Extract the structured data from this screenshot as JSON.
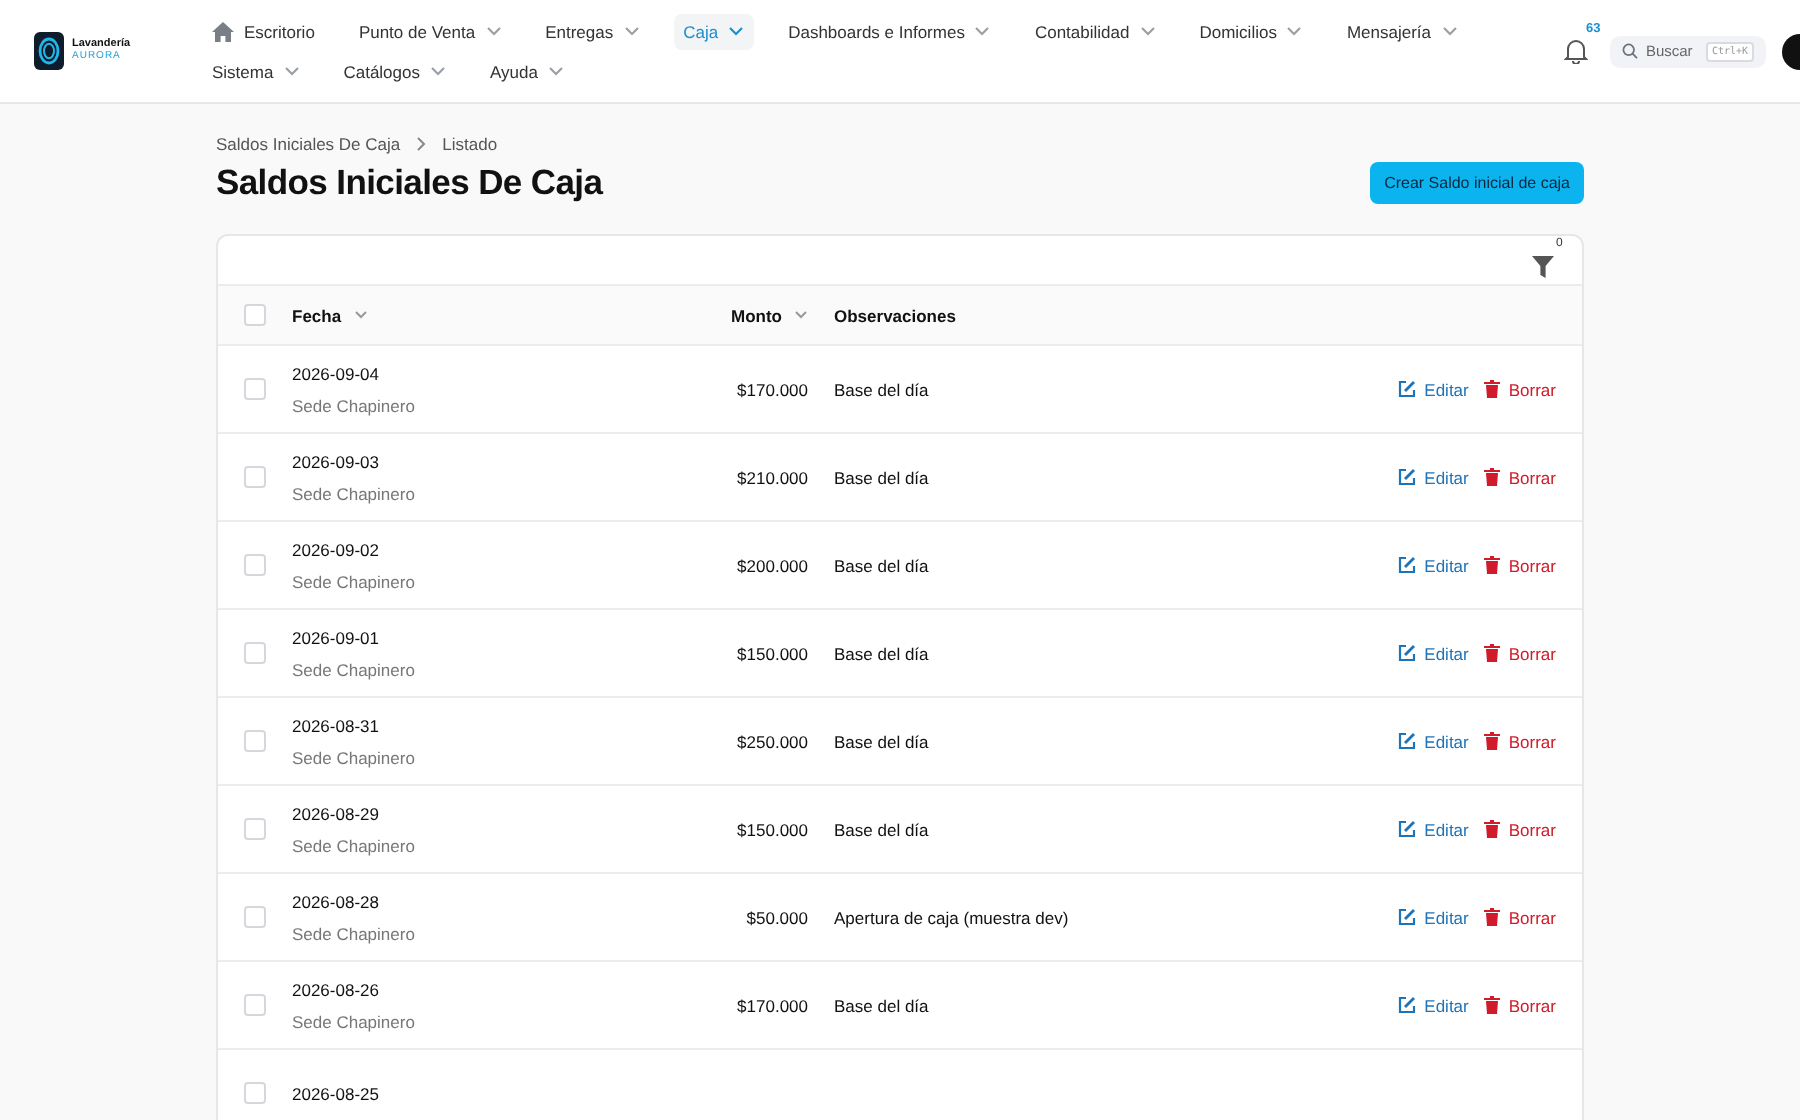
{
  "brand": {
    "name": "Lavandería",
    "tagline": "AURORA"
  },
  "nav": [
    {
      "label": "Escritorio",
      "kind": "home",
      "selected": false
    },
    {
      "label": "Punto de Venta",
      "kind": "menu",
      "selected": false
    },
    {
      "label": "Entregas",
      "kind": "menu",
      "selected": false
    },
    {
      "label": "Caja",
      "kind": "menu",
      "selected": true
    },
    {
      "label": "Dashboards e Informes",
      "kind": "menu",
      "selected": false
    },
    {
      "label": "Contabilidad",
      "kind": "menu",
      "selected": false
    },
    {
      "label": "Domicilios",
      "kind": "menu",
      "selected": false
    },
    {
      "label": "Mensajería",
      "kind": "menu",
      "selected": false
    },
    {
      "label": "Sistema",
      "kind": "menu",
      "selected": false
    },
    {
      "label": "Catálogos",
      "kind": "menu",
      "selected": false
    },
    {
      "label": "Ayuda",
      "kind": "menu",
      "selected": false
    }
  ],
  "notifications": {
    "count": "63"
  },
  "search": {
    "placeholder": "Buscar",
    "shortcut": "Ctrl+K"
  },
  "breadcrumbs": [
    "Saldos Iniciales De Caja",
    "Listado"
  ],
  "title": "Saldos Iniciales De Caja",
  "create_button": "Crear Saldo inicial de caja",
  "filter": {
    "count": "0"
  },
  "table": {
    "select_all": {
      "checked": false
    },
    "columns": [
      {
        "label": "Fecha",
        "sortable": true
      },
      {
        "label": "Monto",
        "sortable": true
      },
      {
        "label": "Observaciones",
        "sortable": false
      }
    ],
    "rows": [
      {
        "fecha": "2026-09-04",
        "sede": "Sede Chapinero",
        "monto": "$170.000",
        "observaciones": "Base del día",
        "edit": "Editar",
        "delete": "Borrar",
        "selected": false
      },
      {
        "fecha": "2026-09-03",
        "sede": "Sede Chapinero",
        "monto": "$210.000",
        "observaciones": "Base del día",
        "edit": "Editar",
        "delete": "Borrar",
        "selected": false
      },
      {
        "fecha": "2026-09-02",
        "sede": "Sede Chapinero",
        "monto": "$200.000",
        "observaciones": "Base del día",
        "edit": "Editar",
        "delete": "Borrar",
        "selected": false
      },
      {
        "fecha": "2026-09-01",
        "sede": "Sede Chapinero",
        "monto": "$150.000",
        "observaciones": "Base del día",
        "edit": "Editar",
        "delete": "Borrar",
        "selected": false
      },
      {
        "fecha": "2026-08-31",
        "sede": "Sede Chapinero",
        "monto": "$250.000",
        "observaciones": "Base del día",
        "edit": "Editar",
        "delete": "Borrar",
        "selected": false
      },
      {
        "fecha": "2026-08-29",
        "sede": "Sede Chapinero",
        "monto": "$150.000",
        "observaciones": "Base del día",
        "edit": "Editar",
        "delete": "Borrar",
        "selected": false
      },
      {
        "fecha": "2026-08-28",
        "sede": "Sede Chapinero",
        "monto": "$50.000",
        "observaciones": "Apertura de caja (muestra dev)",
        "edit": "Editar",
        "delete": "Borrar",
        "selected": false
      },
      {
        "fecha": "2026-08-26",
        "sede": "Sede Chapinero",
        "monto": "$170.000",
        "observaciones": "Base del día",
        "edit": "Editar",
        "delete": "Borrar",
        "selected": false
      },
      {
        "fecha": "2026-08-25",
        "selected": false
      }
    ]
  }
}
